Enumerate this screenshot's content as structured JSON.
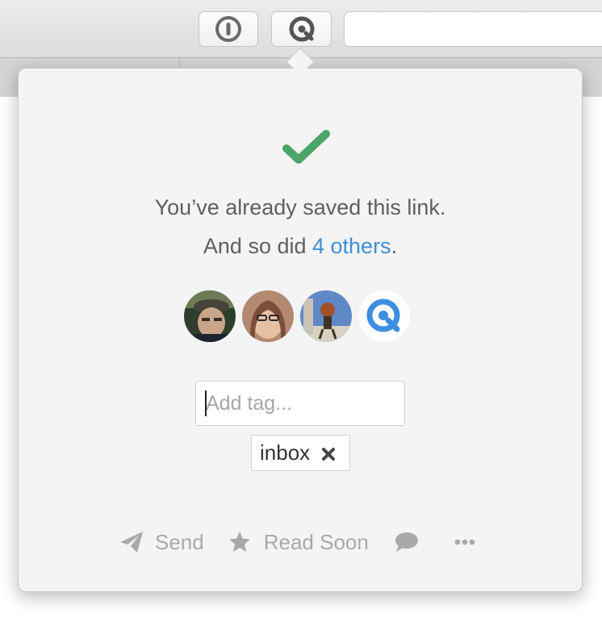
{
  "toolbar": {
    "buttons": [
      {
        "name": "1password-extension",
        "icon": "1password-keyhole-icon"
      },
      {
        "name": "instapaper-extension",
        "icon": "instapaper-logo-icon"
      }
    ],
    "address_bar": {
      "value": ""
    }
  },
  "popover": {
    "status_icon": "checkmark-icon",
    "status_color": "#4aa56b",
    "message_line1": "You’ve already saved this link.",
    "message_line2_prefix": "And so did ",
    "others_link": "4 others",
    "message_line2_suffix": ".",
    "link_color": "#3f8fd6",
    "avatars": [
      {
        "name": "user-avatar-1"
      },
      {
        "name": "user-avatar-2"
      },
      {
        "name": "user-avatar-3"
      },
      {
        "name": "instapaper-avatar"
      }
    ],
    "tag_input": {
      "placeholder": "Add tag...",
      "value": ""
    },
    "tags": [
      {
        "label": "inbox",
        "remove_icon": "close-x-icon"
      }
    ],
    "actions": [
      {
        "label": "Send",
        "icon": "paper-plane-icon"
      },
      {
        "label": "Read Soon",
        "icon": "star-icon"
      },
      {
        "label": "",
        "icon": "speech-bubble-icon"
      },
      {
        "label": "",
        "icon": "ellipsis-icon"
      }
    ]
  }
}
